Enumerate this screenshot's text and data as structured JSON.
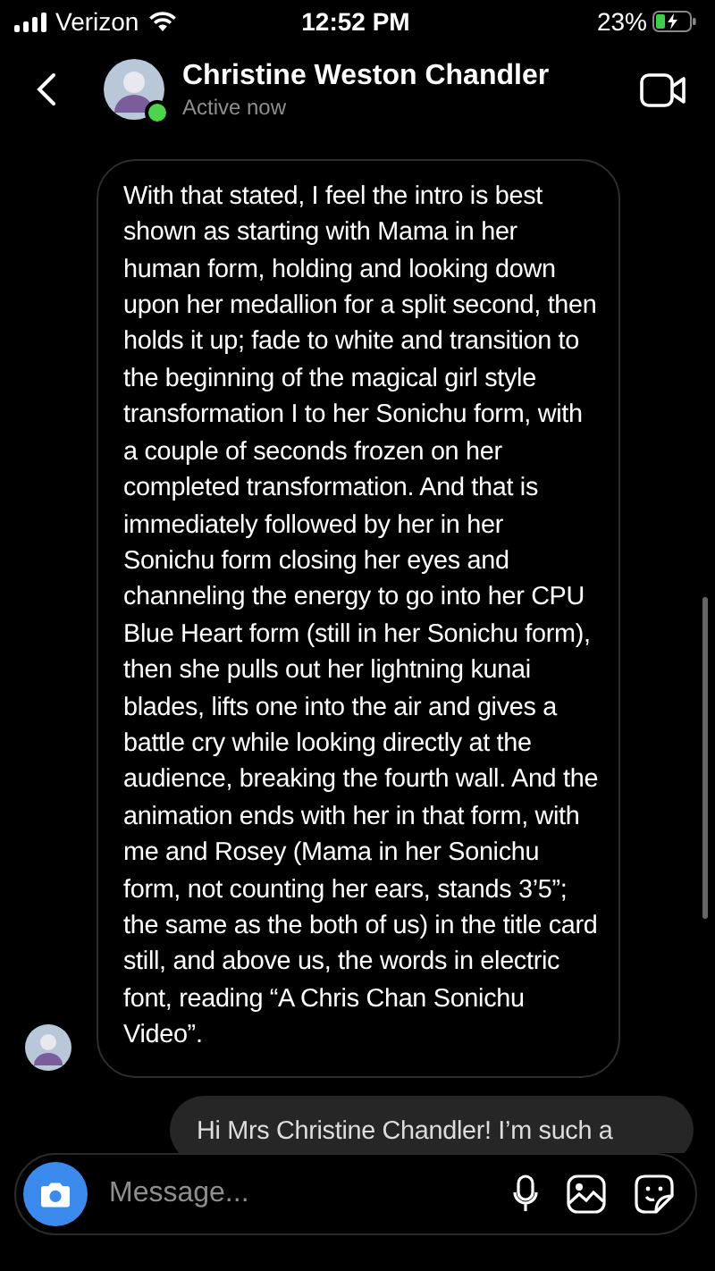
{
  "status_bar": {
    "carrier": "Verizon",
    "time": "12:52 PM",
    "battery": "23%"
  },
  "header": {
    "name": "Christine Weston Chandler",
    "status": "Active now",
    "online": true
  },
  "messages": [
    {
      "kind": "incoming",
      "text": "With that stated, I feel the intro is best shown as starting with Mama in her human form, holding and looking down upon her medallion for a split second, then holds it up; fade to white and transition to the beginning of the magical girl style transformation I to her Sonichu form, with a couple of seconds frozen on her completed transformation.  And that is immediately followed by her in her Sonichu form closing her eyes and channeling the energy to go into her CPU Blue Heart form (still in her Sonichu form), then she pulls out her lightning kunai blades, lifts one into the air and gives a battle cry while looking directly at the audience, breaking the fourth wall.  And the animation ends with her in that form, with me and Rosey (Mama in her Sonichu form, not counting her ears, stands 3’5”; the same as the both of us) in the title card still, and above us, the words in electric font, reading “A Chris Chan Sonichu Video”."
    },
    {
      "kind": "outgoing",
      "text": "Hi Mrs Christine Chandler! I’m such a"
    }
  ],
  "composer": {
    "placeholder": "Message..."
  }
}
